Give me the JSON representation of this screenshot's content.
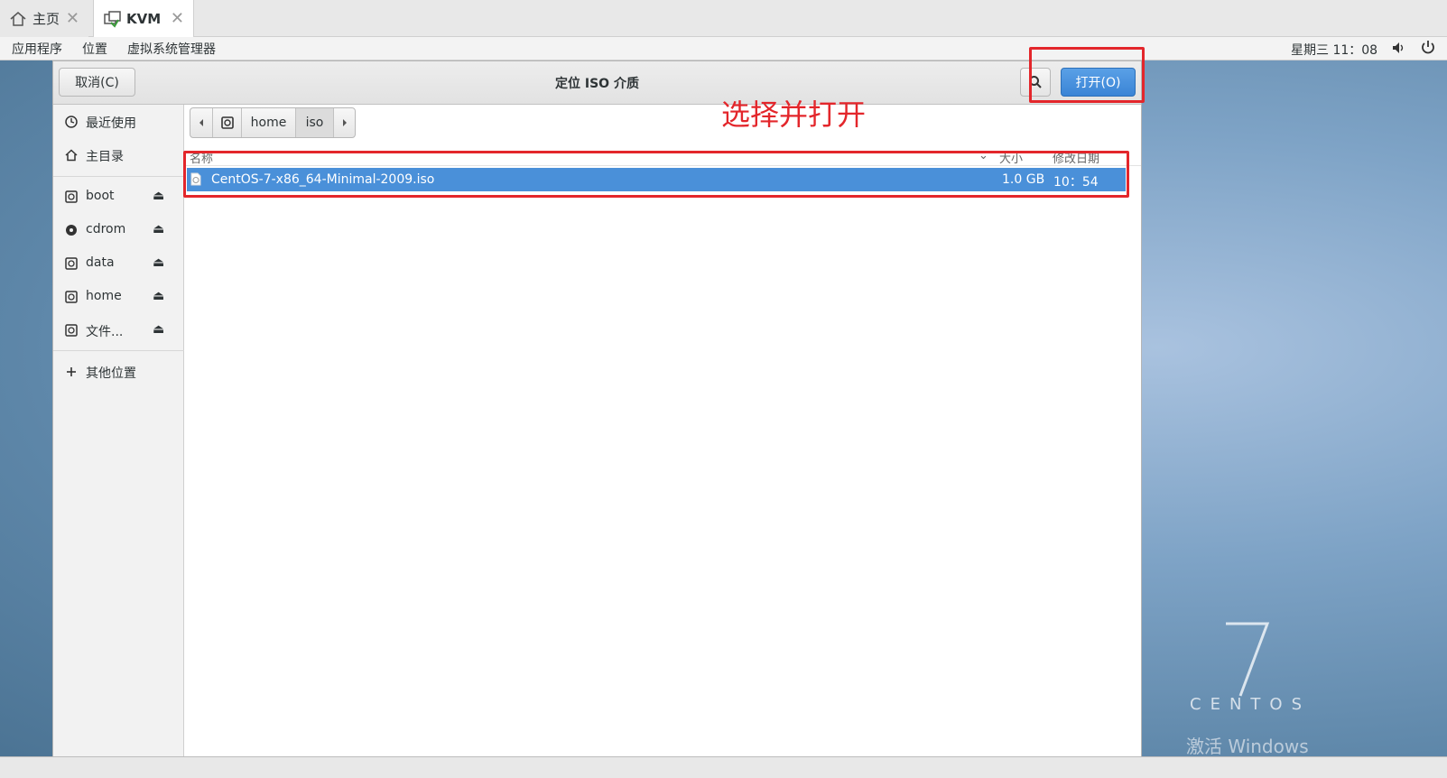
{
  "tabs": [
    {
      "label": "主页",
      "icon": "home-icon"
    },
    {
      "label": "KVM",
      "icon": "vm-icon"
    }
  ],
  "panel": {
    "menus": [
      "应用程序",
      "位置",
      "虚拟系统管理器"
    ],
    "clock": "星期三 11：08"
  },
  "dialog": {
    "title": "定位 ISO 介质",
    "cancel_label": "取消(C)",
    "open_label": "打开(O)"
  },
  "sidebar": {
    "items": [
      {
        "label": "最近使用",
        "icon": "clock-icon"
      },
      {
        "label": "主目录",
        "icon": "home-icon"
      },
      {
        "label": "boot",
        "icon": "drive-icon"
      },
      {
        "label": "cdrom",
        "icon": "disc-icon"
      },
      {
        "label": "data",
        "icon": "drive-icon"
      },
      {
        "label": "home",
        "icon": "drive-icon"
      },
      {
        "label": "文件...",
        "icon": "drive-icon"
      },
      {
        "label": "其他位置",
        "icon": "plus-icon"
      }
    ]
  },
  "pathbar": {
    "segments": [
      "home",
      "iso"
    ]
  },
  "columns": {
    "name": "名称",
    "size": "大小",
    "modified": "修改日期"
  },
  "files": [
    {
      "name": "CentOS-7-x86_64-Minimal-2009.iso",
      "size": "1.0 GB",
      "modified": "10：54"
    }
  ],
  "annotation": {
    "text": "选择并打开",
    "color": "#e3262b"
  },
  "desktop": {
    "version": "7",
    "brand": "CENTOS",
    "watermark": "激活 Windows"
  },
  "colors": {
    "accent": "#4a90d9",
    "annotation": "#e3262b"
  }
}
